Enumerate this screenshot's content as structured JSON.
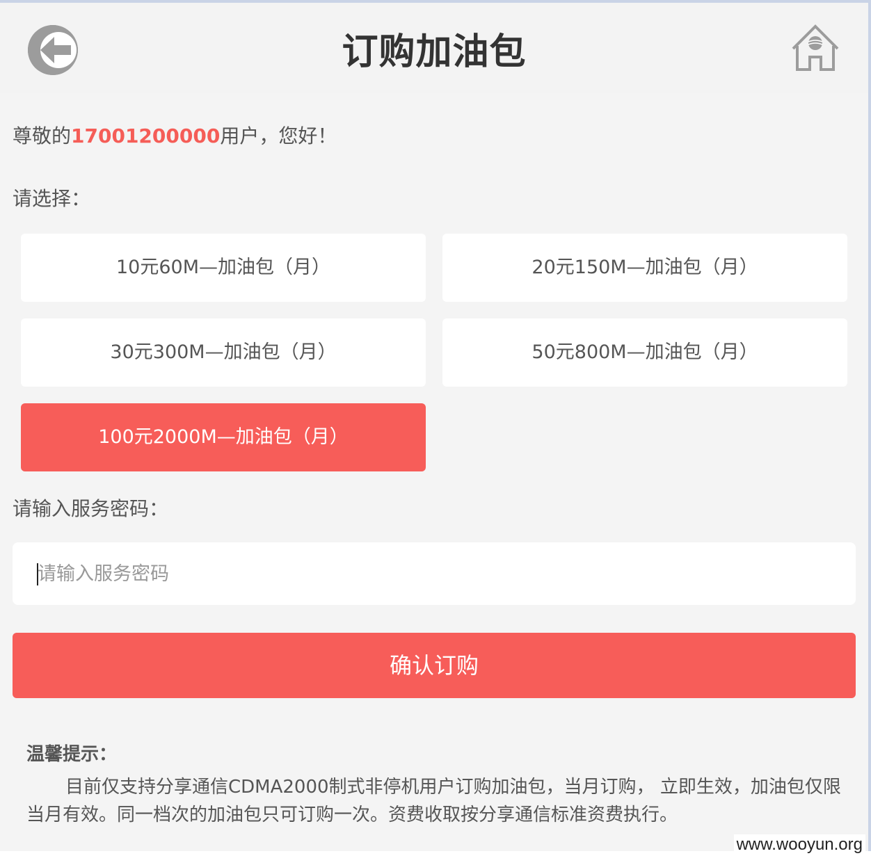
{
  "header": {
    "title": "订购加油包",
    "back_icon": "back-arrow-icon",
    "home_icon": "home-icon"
  },
  "greeting": {
    "prefix": "尊敬的",
    "phone": "17001200000",
    "suffix": "用户，您好！"
  },
  "select_label": "请选择：",
  "packages": [
    {
      "label": "10元60M—加油包（月）",
      "selected": false
    },
    {
      "label": "20元150M—加油包（月）",
      "selected": false
    },
    {
      "label": "30元300M—加油包（月）",
      "selected": false
    },
    {
      "label": "50元800M—加油包（月）",
      "selected": false
    },
    {
      "label": "100元2000M—加油包（月）",
      "selected": true
    }
  ],
  "password": {
    "label": "请输入服务密码：",
    "placeholder": "请输入服务密码",
    "value": ""
  },
  "confirm_label": "确认订购",
  "tips": {
    "title": "温馨提示：",
    "text": "目前仅支持分享通信CDMA2000制式非停机用户订购加油包，当月订购， 立即生效，加油包仅限当月有效。同一档次的加油包只可订购一次。资费收取按分享通信标准资费执行。"
  },
  "watermark": "www.wooyun.org",
  "colors": {
    "accent": "#f75d59",
    "phone_highlight": "#f55d57",
    "background": "#f4f4f4"
  }
}
